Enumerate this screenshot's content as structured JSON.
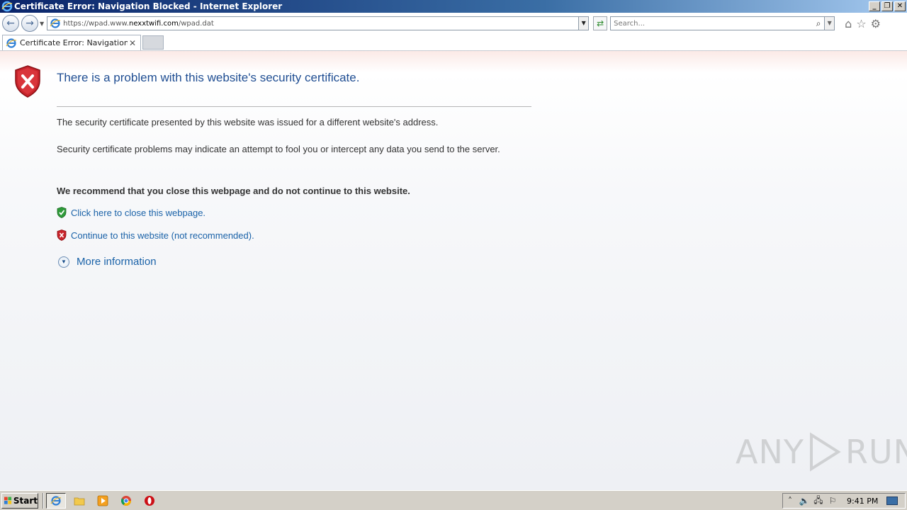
{
  "window": {
    "title": "Certificate Error: Navigation Blocked - Internet Explorer",
    "minimize": "_",
    "restore": "❐",
    "close": "✕"
  },
  "navbar": {
    "back_glyph": "←",
    "forward_glyph": "→",
    "url_prefix": "https://wpad.www.",
    "url_domain": "nexxtwifi.com",
    "url_suffix": "/wpad.dat",
    "search_placeholder": "Search..."
  },
  "tabs": [
    {
      "label": "Certificate Error: Navigation ...",
      "close": "✕"
    }
  ],
  "page": {
    "title": "There is a problem with this website's security certificate.",
    "para1": "The security certificate presented by this website was issued for a different website's address.",
    "para2": "Security certificate problems may indicate an attempt to fool you or intercept any data you send to the server.",
    "recommend": "We recommend that you close this webpage and do not continue to this website.",
    "close_link": "Click here to close this webpage.",
    "continue_link": "Continue to this website (not recommended).",
    "more_info": "More information"
  },
  "watermark": {
    "left": "ANY",
    "right": "RUN"
  },
  "taskbar": {
    "start_label": "Start",
    "clock": "9:41 PM"
  },
  "colors": {
    "link": "#1a62a8",
    "title": "#1f4d92",
    "shield_red": "#c8242b",
    "shield_green": "#2e9a3a"
  }
}
